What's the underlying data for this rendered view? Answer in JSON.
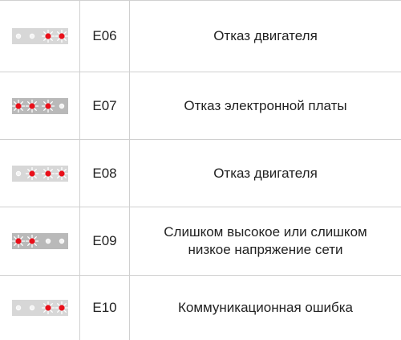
{
  "colors": {
    "led_on": "#e8101a",
    "led_off": "#f4f4f4",
    "grid": "#d0d0d0",
    "strip_light": "#d7d7d7",
    "strip_dark": "#b9b9b9"
  },
  "rows": [
    {
      "code": "E06",
      "description": [
        "Отказ двигателя"
      ],
      "indicator": {
        "leds": [
          "off",
          "off",
          "on",
          "on"
        ],
        "strip_tone": "light"
      }
    },
    {
      "code": "E07",
      "description": [
        "Отказ электронной платы"
      ],
      "indicator": {
        "leds": [
          "on",
          "on",
          "on",
          "off"
        ],
        "strip_tone": "dark"
      }
    },
    {
      "code": "E08",
      "description": [
        "Отказ двигателя"
      ],
      "indicator": {
        "leds": [
          "off",
          "on",
          "on",
          "on"
        ],
        "strip_tone": "light"
      }
    },
    {
      "code": "E09",
      "description": [
        "Слишком высокое или слишком",
        "низкое напряжение сети"
      ],
      "indicator": {
        "leds": [
          "on",
          "on",
          "off",
          "off"
        ],
        "strip_tone": "dark"
      }
    },
    {
      "code": "E10",
      "description": [
        "Коммуникационная ошибка"
      ],
      "indicator": {
        "leds": [
          "off",
          "off",
          "on",
          "on"
        ],
        "strip_tone": "light"
      }
    }
  ]
}
